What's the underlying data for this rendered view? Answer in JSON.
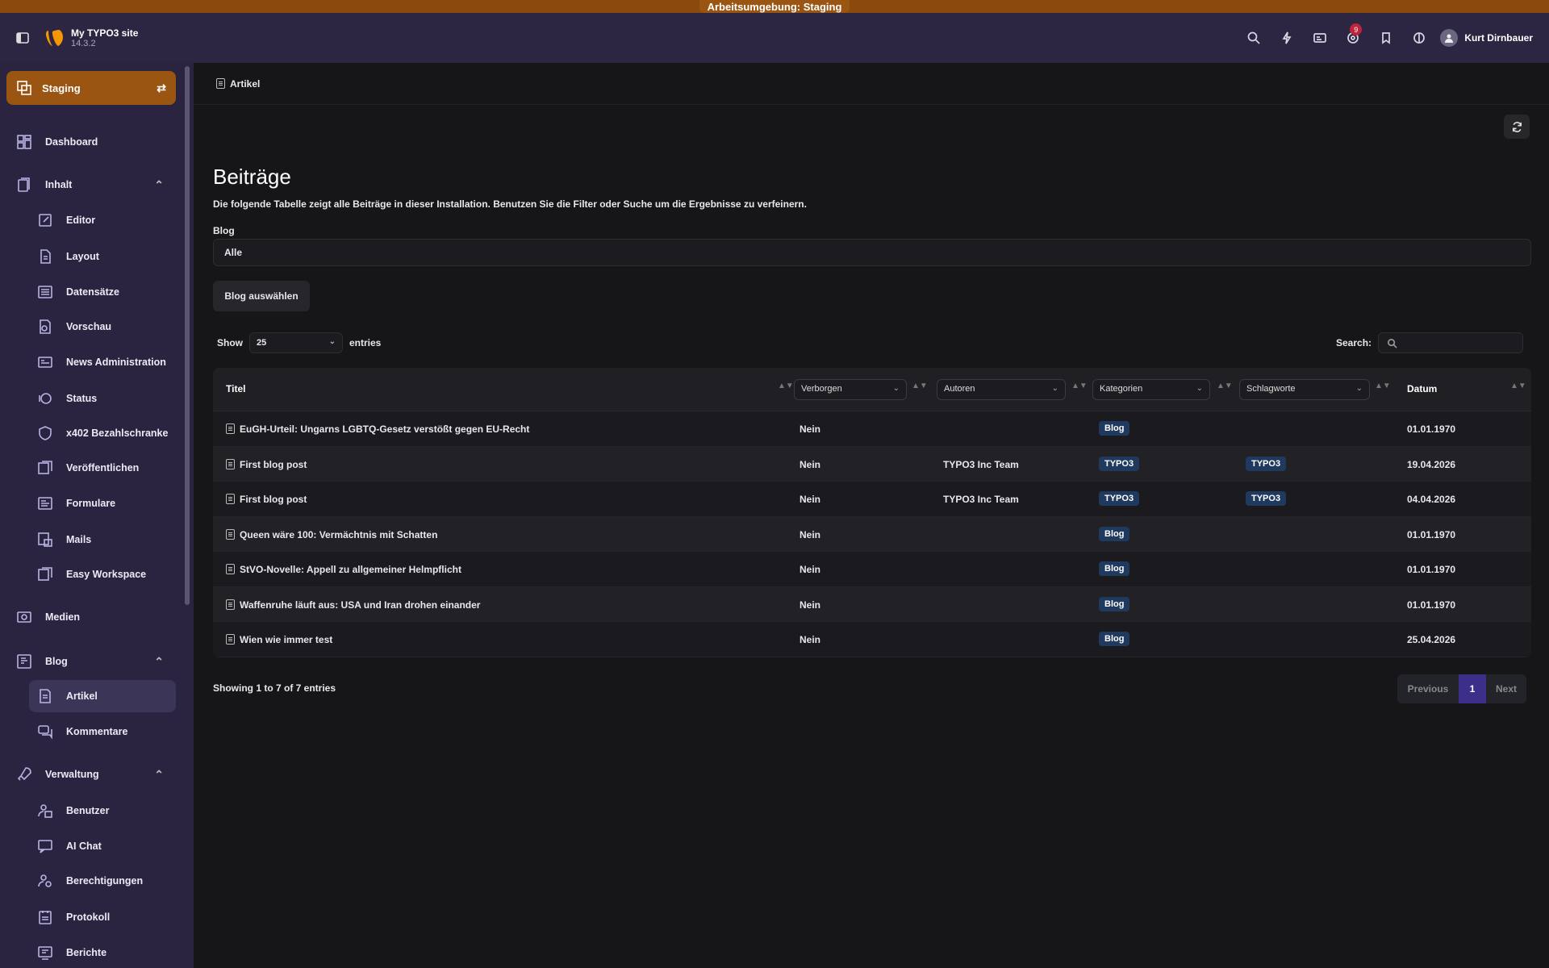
{
  "env_banner": "Arbeitsumgebung: Staging",
  "site": {
    "name": "My TYPO3 site",
    "version": "14.3.2"
  },
  "topbar": {
    "notification_count": "9",
    "user_name": "Kurt Dirnbauer"
  },
  "workspace": {
    "label": "Staging"
  },
  "nav": {
    "dashboard": "Dashboard",
    "inhalt": "Inhalt",
    "editor": "Editor",
    "layout": "Layout",
    "datensaetze": "Datensätze",
    "vorschau": "Vorschau",
    "news_admin": "News Administration",
    "status": "Status",
    "x402": "x402 Bezahlschranke",
    "veroeffentlichen": "Veröffentlichen",
    "formulare": "Formulare",
    "mails": "Mails",
    "easy_workspace": "Easy Workspace",
    "medien": "Medien",
    "blog": "Blog",
    "artikel": "Artikel",
    "kommentare": "Kommentare",
    "verwaltung": "Verwaltung",
    "benutzer": "Benutzer",
    "ai_chat": "AI Chat",
    "berechtigungen": "Berechtigungen",
    "protokoll": "Protokoll",
    "berichte": "Berichte"
  },
  "breadcrumb": "Artikel",
  "page": {
    "title": "Beiträge",
    "description": "Die folgende Tabelle zeigt alle Beiträge in dieser Installation. Benutzen Sie die Filter oder Suche um die Ergebnisse zu verfeinern.",
    "blog_label": "Blog",
    "blog_value": "Alle",
    "blog_button": "Blog auswählen"
  },
  "table_controls": {
    "show_label": "Show",
    "entries_value": "25",
    "entries_label": "entries",
    "search_label": "Search:",
    "info": "Showing 1 to 7 of 7 entries"
  },
  "table": {
    "col_titel": "Titel",
    "filter_verborgen": "Verborgen",
    "filter_autoren": "Autoren",
    "filter_kategorien": "Kategorien",
    "filter_schlagworte": "Schlagworte",
    "col_datum": "Datum",
    "rows": [
      {
        "titel": "EuGH-Urteil: Ungarns LGBTQ-Gesetz verstößt gegen EU-Recht",
        "verborgen": "Nein",
        "autoren": "",
        "kategorie": "Blog",
        "schlagwort": "",
        "datum": "01.01.1970"
      },
      {
        "titel": "First blog post",
        "verborgen": "Nein",
        "autoren": "TYPO3 Inc Team",
        "kategorie": "TYPO3",
        "schlagwort": "TYPO3",
        "datum": "19.04.2026"
      },
      {
        "titel": "First blog post",
        "verborgen": "Nein",
        "autoren": "TYPO3 Inc Team",
        "kategorie": "TYPO3",
        "schlagwort": "TYPO3",
        "datum": "04.04.2026"
      },
      {
        "titel": "Queen wäre 100: Vermächtnis mit Schatten",
        "verborgen": "Nein",
        "autoren": "",
        "kategorie": "Blog",
        "schlagwort": "",
        "datum": "01.01.1970"
      },
      {
        "titel": "StVO-Novelle: Appell zu allgemeiner Helmpflicht",
        "verborgen": "Nein",
        "autoren": "",
        "kategorie": "Blog",
        "schlagwort": "",
        "datum": "01.01.1970"
      },
      {
        "titel": "Waffenruhe läuft aus: USA und Iran drohen einander",
        "verborgen": "Nein",
        "autoren": "",
        "kategorie": "Blog",
        "schlagwort": "",
        "datum": "01.01.1970"
      },
      {
        "titel": "Wien wie immer test",
        "verborgen": "Nein",
        "autoren": "",
        "kategorie": "Blog",
        "schlagwort": "",
        "datum": "25.04.2026"
      }
    ]
  },
  "pager": {
    "previous": "Previous",
    "current": "1",
    "next": "Next"
  }
}
